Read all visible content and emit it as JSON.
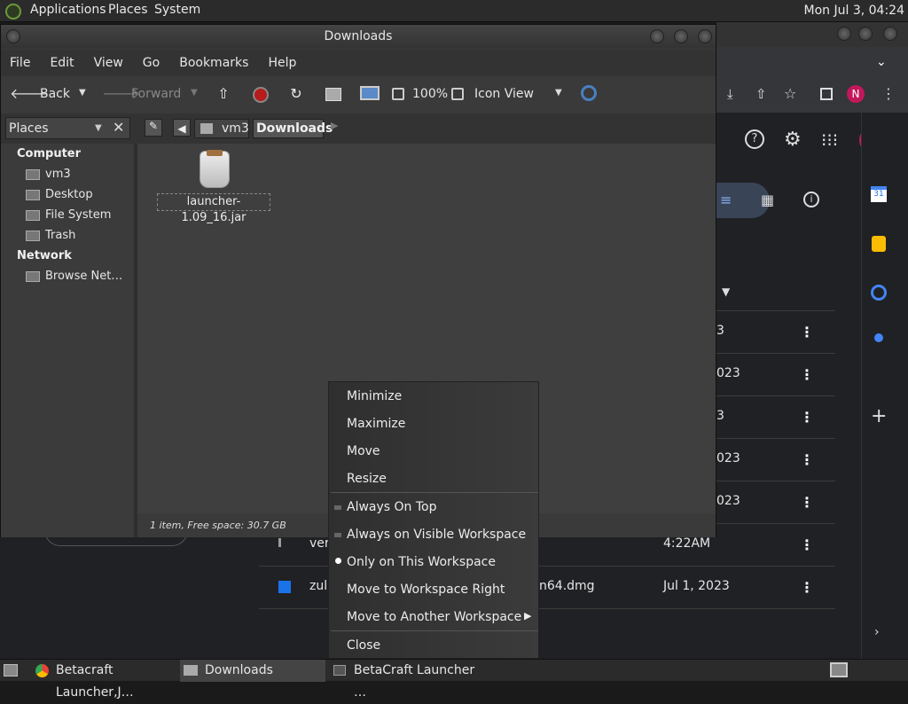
{
  "top_panel": {
    "applications": "Applications",
    "places": "Places",
    "system": "System",
    "clock": "Mon Jul 3, 04:24"
  },
  "window": {
    "title": "Downloads"
  },
  "menu": [
    "File",
    "Edit",
    "View",
    "Go",
    "Bookmarks",
    "Help"
  ],
  "toolbar": {
    "back": "Back",
    "forward": "Forward",
    "zoom": "100%",
    "view_mode": "Icon View"
  },
  "location": {
    "segments": [
      "vm3",
      "Downloads"
    ]
  },
  "sidebar": {
    "selector": "Places",
    "computer_heading": "Computer",
    "items": [
      "vm3",
      "Desktop",
      "File System",
      "Trash"
    ],
    "network_heading": "Network",
    "network_items": [
      "Browse Net…"
    ]
  },
  "files": [
    {
      "name": "launcher-1.09_16.jar"
    }
  ],
  "status": "1 item, Free space: 30.7 GB",
  "context_menu": {
    "items": [
      "Minimize",
      "Maximize",
      "Move",
      "Resize"
    ],
    "checks": [
      "Always On Top",
      "Always on Visible Workspace",
      "Only on This Workspace"
    ],
    "workspace": [
      "Move to Workspace Right",
      "Move to Another Workspace"
    ],
    "close": "Close"
  },
  "chrome_rows": [
    {
      "date": "3"
    },
    {
      "date": "023"
    },
    {
      "date": "3"
    },
    {
      "date": "023"
    },
    {
      "date": "023"
    },
    {
      "name": "ver",
      "date": "4:22AM"
    },
    {
      "name": "zul",
      "name_end": "n64.dmg",
      "date": "Jul 1, 2023"
    }
  ],
  "taskbar": {
    "items": [
      "Betacraft Launcher,J…",
      "Downloads",
      "BetaCraft Launcher …"
    ]
  },
  "colors": {
    "accent_blue": "#8ab4f8",
    "avatar": "#c2185b"
  }
}
